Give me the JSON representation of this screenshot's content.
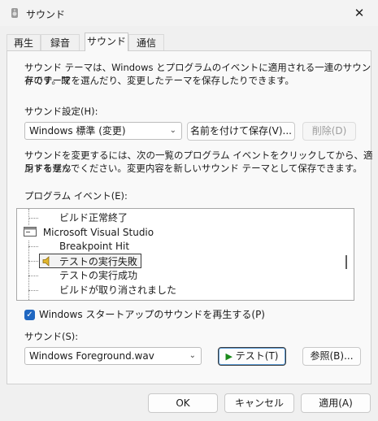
{
  "window": {
    "title": "サウンド",
    "close_glyph": "✕"
  },
  "tabs": [
    {
      "label": "再生"
    },
    {
      "label": "録音"
    },
    {
      "label": "サウンド"
    },
    {
      "label": "通信"
    }
  ],
  "description": {
    "line1": "サウンド テーマは、Windows とプログラムのイベントに適用される一連のサウンドです。既",
    "line2": "存のテーマを選んだり、変更したテーマを保存したりできます。"
  },
  "scheme": {
    "label": "サウンド設定(H):",
    "value": "Windows 標準 (変更)",
    "save_as_label": "名前を付けて保存(V)...",
    "delete_label": "削除(D)"
  },
  "instructions": {
    "line1": "サウンドを変更するには、次の一覧のプログラム イベントをクリックしてから、適用するサウ",
    "line2": "ンドを選んでください。変更内容を新しいサウンド テーマとして保存できます。"
  },
  "events": {
    "label": "プログラム イベント(E):",
    "items": [
      {
        "label": "ビルド正常終了",
        "has_sound": false
      },
      {
        "label": "Microsoft Visual Studio",
        "is_group": true
      },
      {
        "label": "Breakpoint Hit",
        "has_sound": false
      },
      {
        "label": "テストの実行失敗",
        "has_sound": true,
        "selected": true
      },
      {
        "label": "テストの実行成功",
        "has_sound": false
      },
      {
        "label": "ビルドが取り消されました",
        "has_sound": false
      }
    ]
  },
  "startup_sound": {
    "label": "Windows スタートアップのサウンドを再生する(P)",
    "checked": true
  },
  "sound": {
    "label": "サウンド(S):",
    "value": "Windows Foreground.wav",
    "test_label": "テスト(T)",
    "browse_label": "参照(B)..."
  },
  "footer": {
    "ok_label": "OK",
    "cancel_label": "キャンセル",
    "apply_label": "適用(A)"
  },
  "colors": {
    "accent": "#1f67c1",
    "selection_border": "#3c3c3c",
    "play_icon": "#1a8a1a",
    "speaker_icon": "#e2b72c"
  }
}
